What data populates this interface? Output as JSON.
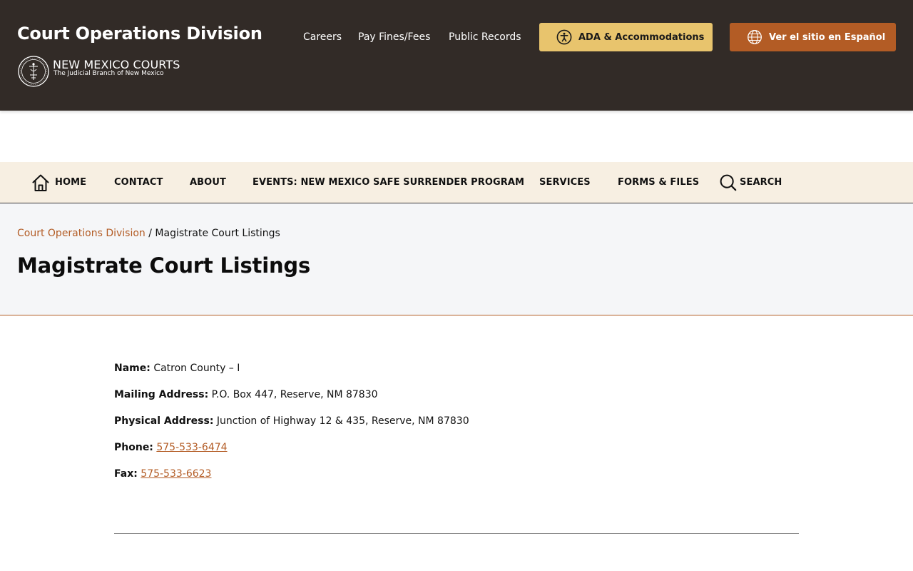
{
  "header": {
    "site_title": "Court Operations Division",
    "logo_name": "NEW MEXICO COURTS",
    "logo_tagline": "The Judicial Branch of New Mexico",
    "utility_links": [
      "Careers",
      "Pay Fines/Fees",
      "Public Records"
    ],
    "ada_button": "ADA & Accommodations",
    "spanish_button": "Ver el sitio en Español",
    "colors": {
      "background": "#322b27",
      "ada_button": "#e8c46d",
      "spanish_button": "#b35c25"
    }
  },
  "nav": {
    "items": [
      "HOME",
      "CONTACT",
      "ABOUT",
      "EVENTS: NEW MEXICO SAFE SURRENDER PROGRAM",
      "SERVICES",
      "FORMS & FILES",
      "SEARCH"
    ],
    "icons": {
      "home": "home-icon",
      "search": "search-icon"
    },
    "background": "#f7efe2"
  },
  "breadcrumb": {
    "parent": "Court Operations Division",
    "separator": "/",
    "current": "Magistrate Court Listings"
  },
  "page": {
    "title": "Magistrate Court Listings"
  },
  "listing": {
    "name_label": "Name:",
    "name": "Catron County – I",
    "mailing_label": "Mailing Address:",
    "mailing": "P.O. Box 447, Reserve, NM 87830",
    "physical_label": "Physical Address:",
    "physical": "Junction of Highway 12 & 435, Reserve, NM 87830",
    "phone_label": "Phone:",
    "phone": "575-533-6474",
    "fax_label": "Fax:",
    "fax": "575-533-6623"
  },
  "accent_color": "#b35c25"
}
